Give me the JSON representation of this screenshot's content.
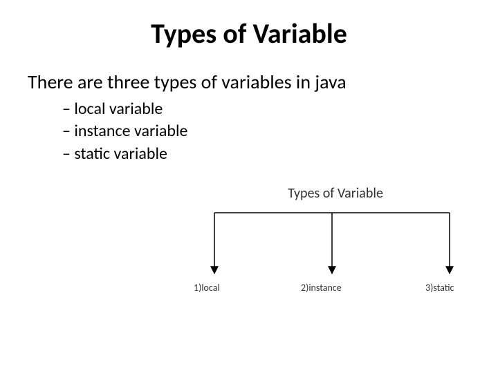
{
  "title": "Types of Variable",
  "intro": "There are three types of variables in java",
  "bullets": [
    "local variable",
    "instance variable",
    "static variable"
  ],
  "diagram": {
    "caption": "Types of Variable",
    "labels": [
      "1)local",
      "2)instance",
      "3)static"
    ]
  }
}
